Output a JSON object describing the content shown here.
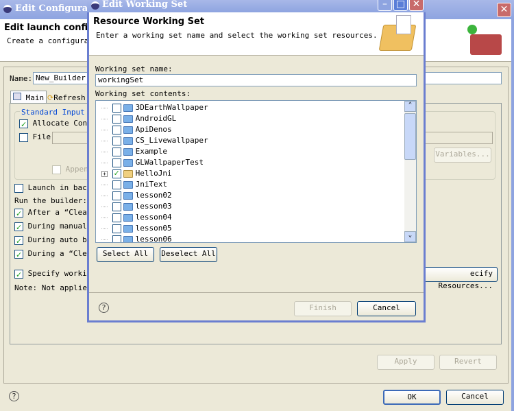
{
  "outer": {
    "title": "Edit Configura",
    "header_title": "Edit launch configur",
    "header_desc": "Create a configuratio",
    "name_label": "Name:",
    "name_value": "New_Builder",
    "tabs": [
      {
        "label": "Main"
      },
      {
        "label": "Refresh"
      }
    ],
    "group_label": "Standard Input an",
    "allocate_console": "Allocate Consol",
    "file": "File",
    "append": "Append",
    "variables": "Variables...",
    "launch_background": "Launch in backgr",
    "run_builder": "Run the builder:",
    "after_clean": "After a “Clean”",
    "manual_build": "During manual bu",
    "auto_build": "During auto buil",
    "during_clean": "During a “Clean”",
    "specify_working": "Specify working",
    "note": "Note: Not applied f",
    "specify_resources": "ecify Resources...",
    "apply": "Apply",
    "revert": "Revert",
    "ok": "OK",
    "cancel": "Cancel"
  },
  "inner": {
    "title": "Edit Working Set",
    "header_title": "Resource Working Set",
    "header_desc": "Enter a working set name and select the working set resources.",
    "name_label": "Working set name:",
    "name_value": "workingSet",
    "contents_label": "Working set contents:",
    "items": [
      {
        "label": "3DEarthWallpaper",
        "checked": false
      },
      {
        "label": "AndroidGL",
        "checked": false
      },
      {
        "label": "ApiDenos",
        "checked": false
      },
      {
        "label": "CS_Livewallpaper",
        "checked": false
      },
      {
        "label": "Example",
        "checked": false
      },
      {
        "label": "GLWallpaperTest",
        "checked": false
      },
      {
        "label": "HelloJni",
        "checked": true,
        "expandable": true
      },
      {
        "label": "JniText",
        "checked": false
      },
      {
        "label": "lesson02",
        "checked": false
      },
      {
        "label": "lesson03",
        "checked": false
      },
      {
        "label": "lesson04",
        "checked": false
      },
      {
        "label": "lesson05",
        "checked": false
      },
      {
        "label": "lesson06",
        "checked": false
      }
    ],
    "select_all": "Select All",
    "deselect_all": "Deselect All",
    "finish": "Finish",
    "cancel": "Cancel"
  }
}
